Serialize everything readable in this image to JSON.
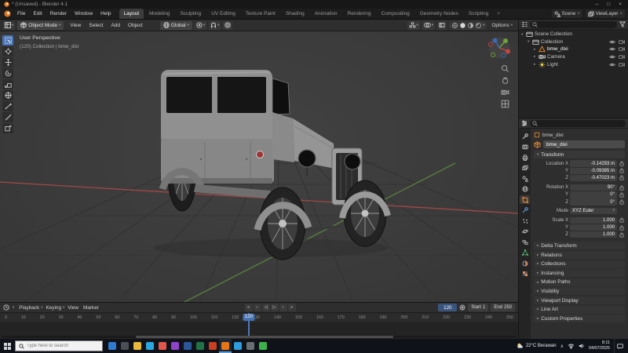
{
  "window": {
    "title": "* (Unsaved) - Blender 4.1",
    "minimize": "–",
    "maximize": "□",
    "close": "×"
  },
  "icons": {
    "caret_down": "▾",
    "caret_right": "▸",
    "close": "×",
    "tray_expand": "∧"
  },
  "topbar": {
    "menus": [
      "File",
      "Edit",
      "Render",
      "Window",
      "Help"
    ],
    "workspaces": [
      {
        "label": "Layout",
        "state": "active"
      },
      {
        "label": "Modeling",
        "state": ""
      },
      {
        "label": "Sculpting",
        "state": ""
      },
      {
        "label": "UV Editing",
        "state": ""
      },
      {
        "label": "Texture Paint",
        "state": ""
      },
      {
        "label": "Shading",
        "state": ""
      },
      {
        "label": "Animation",
        "state": ""
      },
      {
        "label": "Rendering",
        "state": ""
      },
      {
        "label": "Compositing",
        "state": ""
      },
      {
        "label": "Geometry Nodes",
        "state": ""
      },
      {
        "label": "Scripting",
        "state": ""
      },
      {
        "label": "+",
        "state": "plus"
      }
    ],
    "scene_label": "Scene",
    "viewlayer_label": "ViewLayer"
  },
  "toolheader": {
    "mode": "Object Mode",
    "menus": [
      "View",
      "Select",
      "Add",
      "Object"
    ],
    "orientation": "Global",
    "options": "Options"
  },
  "viewport": {
    "view_label": "User Perspective",
    "collection_label": "(120) Collection | bmw_dixi"
  },
  "outliner": {
    "rows": [
      {
        "label": "Scene Collection",
        "caret": "▾",
        "depth": "d0",
        "icon_class": "icon-collection",
        "ctl": "no-ctl",
        "state": ""
      },
      {
        "label": "Collection",
        "caret": "▾",
        "depth": "d1",
        "icon_class": "icon-collection",
        "ctl": "has-ctl",
        "state": ""
      },
      {
        "label": "bmw_dixi",
        "caret": "▸",
        "depth": "d2",
        "icon_class": "icon-mesh",
        "ctl": "has-ctl",
        "state": "sel"
      },
      {
        "label": "Camera",
        "caret": "▸",
        "depth": "d2",
        "icon_class": "icon-camera",
        "ctl": "has-ctl",
        "state": ""
      },
      {
        "label": "Light",
        "caret": "▸",
        "depth": "d2",
        "icon_class": "icon-light",
        "ctl": "has-ctl",
        "state": ""
      }
    ]
  },
  "properties": {
    "breadcrumb_object": "bmw_dixi",
    "name_value": "bmw_dixi",
    "transform_title": "Transform",
    "location_rows": [
      {
        "label": "Location X",
        "value": "-0.14293 m"
      },
      {
        "label": "Y",
        "value": "-0.09385 m"
      },
      {
        "label": "Z",
        "value": "-0.47023 m"
      }
    ],
    "rotation_rows": [
      {
        "label": "Rotation X",
        "value": "90°"
      },
      {
        "label": "Y",
        "value": "0°"
      },
      {
        "label": "Z",
        "value": "0°"
      }
    ],
    "mode_label": "Mode",
    "mode_value": "XYZ Euler",
    "scale_rows": [
      {
        "label": "Scale X",
        "value": "1.000"
      },
      {
        "label": "Y",
        "value": "1.000"
      },
      {
        "label": "Z",
        "value": "1.000"
      }
    ],
    "sections": [
      "Delta Transform",
      "Relations",
      "Collections",
      "Instancing",
      "Motion Paths",
      "Visibility",
      "Viewport Display",
      "Line Art",
      "Custom Properties"
    ]
  },
  "timeline": {
    "menus": [
      {
        "label": "Playback",
        "caret": "▾"
      },
      {
        "label": "Keying",
        "caret": "▾"
      },
      {
        "label": "View",
        "caret": ""
      },
      {
        "label": "Marker",
        "caret": ""
      }
    ],
    "transport": [
      "«",
      "‹",
      "◁",
      "▷",
      "›",
      "»"
    ],
    "current_frame": "120",
    "start_label": "Start",
    "start_value": "1",
    "end_label": "End",
    "end_value": "250",
    "ticks": [
      "0",
      "10",
      "20",
      "30",
      "40",
      "50",
      "60",
      "70",
      "80",
      "90",
      "100",
      "110",
      "120",
      "130",
      "140",
      "150",
      "160",
      "170",
      "180",
      "190",
      "200",
      "210",
      "220",
      "230",
      "240",
      "250"
    ]
  },
  "taskbar": {
    "search_placeholder": "Type here to search",
    "apps": [
      {
        "color": "#2f7bd4",
        "state": ""
      },
      {
        "color": "#4a4f55",
        "state": ""
      },
      {
        "color": "#e8b93c",
        "state": ""
      },
      {
        "color": "#2aa7e0",
        "state": ""
      },
      {
        "color": "#e2574c",
        "state": ""
      },
      {
        "color": "#8f44c8",
        "state": ""
      },
      {
        "color": "#2b579a",
        "state": ""
      },
      {
        "color": "#217346",
        "state": ""
      },
      {
        "color": "#c8401f",
        "state": ""
      },
      {
        "color": "#e87614",
        "state": "active"
      },
      {
        "color": "#2d9cdb",
        "state": ""
      },
      {
        "color": "#6a6f76",
        "state": ""
      },
      {
        "color": "#3bb34a",
        "state": ""
      }
    ],
    "weather": "22°C Berawan",
    "time": "8:11",
    "date": "04/07/2025"
  }
}
